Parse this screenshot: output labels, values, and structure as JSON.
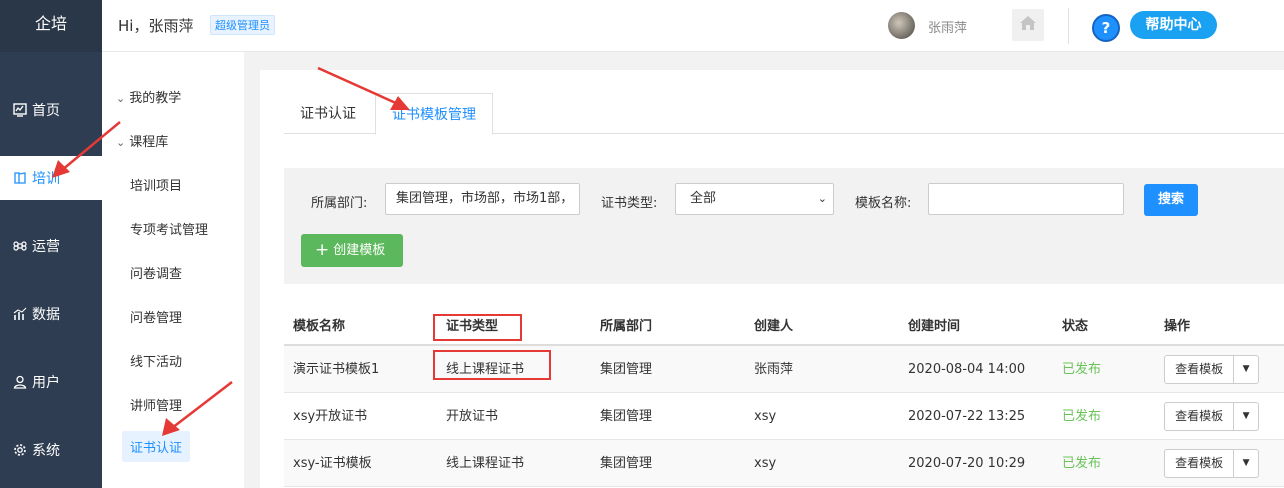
{
  "brand": "企培",
  "nav": [
    {
      "label": "首页",
      "icon": "chart-icon"
    },
    {
      "label": "培训",
      "icon": "book-icon",
      "active": true
    },
    {
      "label": "运营",
      "icon": "command-icon"
    },
    {
      "label": "数据",
      "icon": "bar-chart-icon"
    },
    {
      "label": "用户",
      "icon": "user-icon"
    },
    {
      "label": "系统",
      "icon": "gear-icon"
    }
  ],
  "header": {
    "greeting": "Hi，张雨萍",
    "role": "超级管理员",
    "user_name": "张雨萍",
    "help_label": "帮助中心"
  },
  "subnav": {
    "groups": [
      "我的教学",
      "课程库"
    ],
    "items": [
      "培训项目",
      "专项考试管理",
      "问卷调查",
      "问卷管理",
      "线下活动",
      "讲师管理",
      "证书认证"
    ],
    "active": "证书认证"
  },
  "tabs": [
    {
      "label": "证书认证",
      "active": false
    },
    {
      "label": "证书模板管理",
      "active": true
    }
  ],
  "filter": {
    "dept_label": "所属部门:",
    "dept_value": "集团管理，市场部，市场1部，",
    "type_label": "证书类型:",
    "type_value": "全部",
    "name_label": "模板名称:",
    "name_value": "",
    "search_label": "搜索",
    "create_label": "创建模板"
  },
  "table": {
    "headers": [
      "模板名称",
      "证书类型",
      "所属部门",
      "创建人",
      "创建时间",
      "状态",
      "操作"
    ],
    "rows": [
      {
        "name": "演示证书模板1",
        "type": "线上课程证书",
        "dept": "集团管理",
        "creator": "张雨萍",
        "created": "2020-08-04 14:00",
        "status": "已发布",
        "action": "查看模板"
      },
      {
        "name": "xsy开放证书",
        "type": "开放证书",
        "dept": "集团管理",
        "creator": "xsy",
        "created": "2020-07-22 13:25",
        "status": "已发布",
        "action": "查看模板"
      },
      {
        "name": "xsy-证书模板",
        "type": "线上课程证书",
        "dept": "集团管理",
        "creator": "xsy",
        "created": "2020-07-20 10:29",
        "status": "已发布",
        "action": "查看模板"
      }
    ]
  },
  "colors": {
    "nav_bg": "#2e3d52",
    "accent": "#1e90ff",
    "success": "#6ac259",
    "create_btn": "#5cb85c",
    "annotation": "#e53935"
  }
}
